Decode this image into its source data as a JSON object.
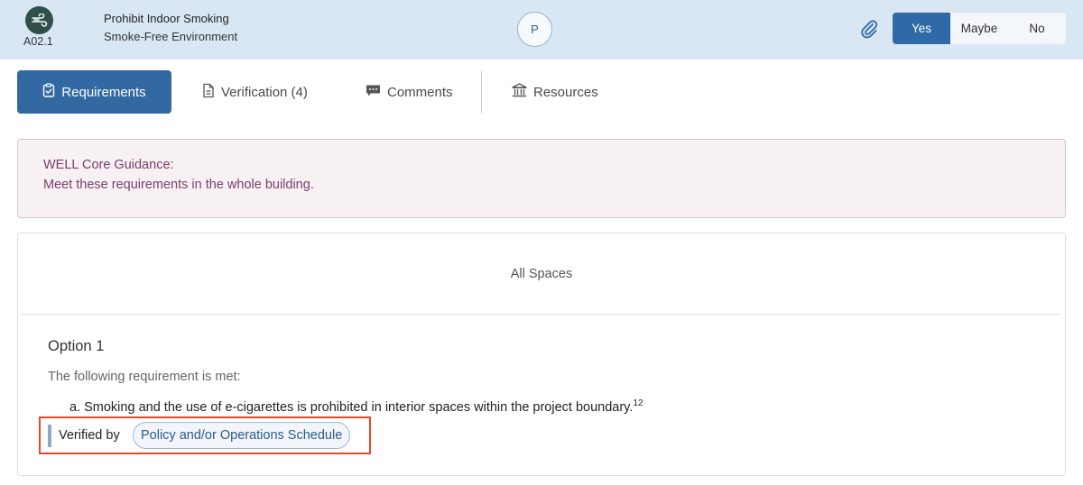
{
  "header": {
    "feature_code": "A02.1",
    "title": "Prohibit Indoor Smoking",
    "subtitle": "Smoke-Free Environment",
    "avatar_initial": "P",
    "icons": {
      "feature": "air-swirl-icon",
      "attachment": "paperclip-icon"
    },
    "answer_options": [
      "Yes",
      "Maybe",
      "No"
    ],
    "selected_answer": "Yes"
  },
  "tabs": [
    {
      "label": "Requirements",
      "icon": "clipboard-check-icon",
      "active": true
    },
    {
      "label": "Verification (4)",
      "icon": "document-icon",
      "active": false
    },
    {
      "label": "Comments",
      "icon": "speech-bubble-icon",
      "active": false
    },
    {
      "label": "Resources",
      "icon": "building-icon",
      "active": false
    }
  ],
  "guidance": {
    "title": "WELL Core Guidance:",
    "text": "Meet these requirements in the whole building."
  },
  "requirements": {
    "scope": "All Spaces",
    "option_title": "Option 1",
    "intro": "The following requirement is met:",
    "item_text": "a. Smoking and the use of e-cigarettes is prohibited in interior spaces within the project boundary.",
    "item_footnotes": "12",
    "verified_label": "Verified by",
    "verification_method": "Policy and/or Operations Schedule"
  },
  "colors": {
    "header_bg": "#d9e7f4",
    "accent": "#3369a3",
    "guidance_text": "#7a3d6e",
    "highlight_border": "#e24a2a"
  }
}
